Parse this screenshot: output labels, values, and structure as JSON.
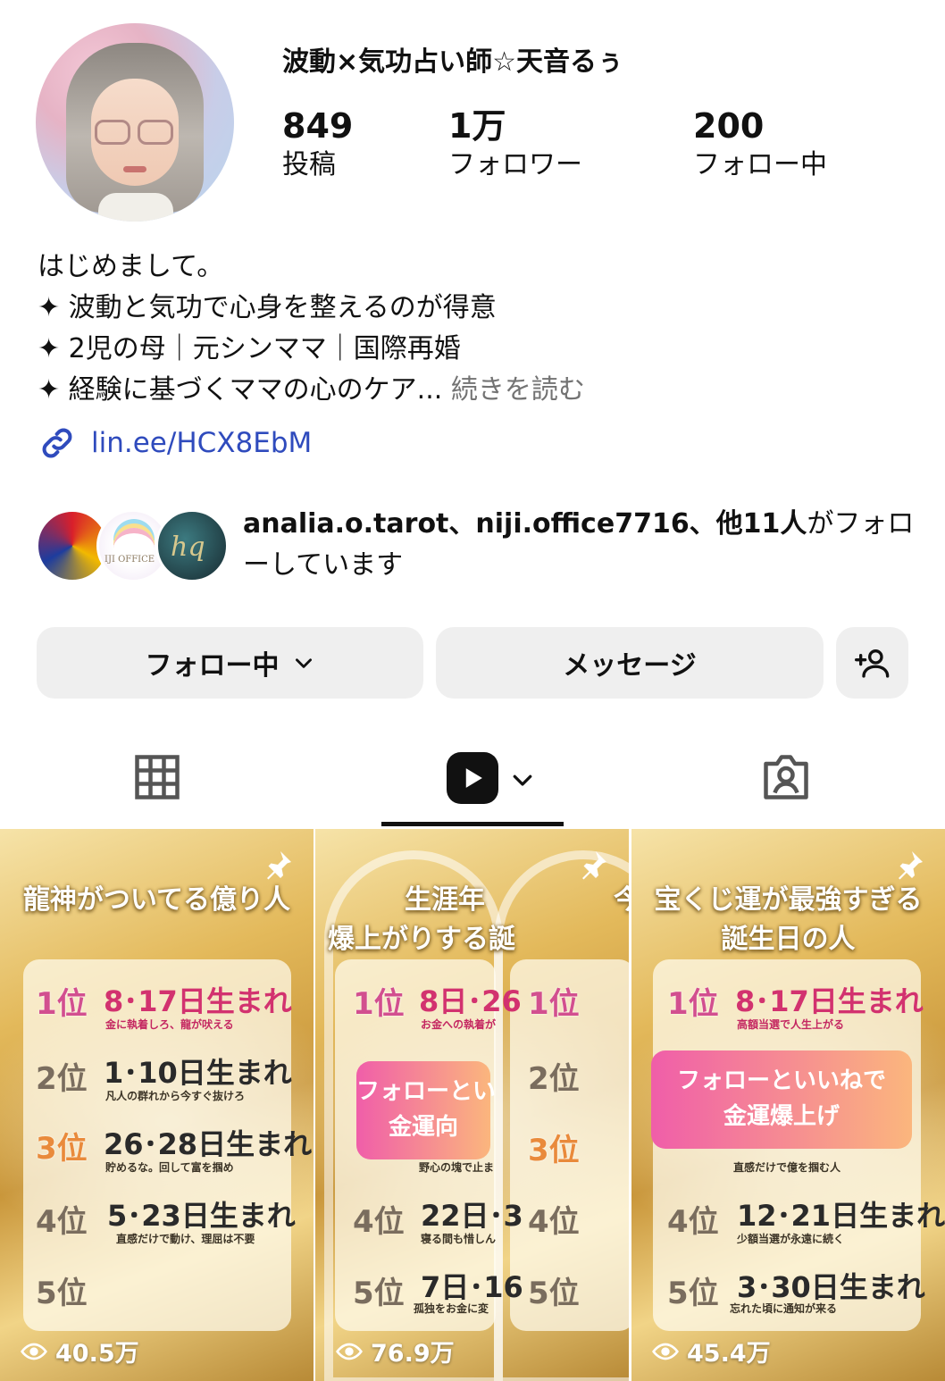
{
  "profile": {
    "username": "波動×気功占い師☆天音るぅ",
    "stats": [
      {
        "value": "849",
        "label": "投稿"
      },
      {
        "value": "1万",
        "label": "フォロワー"
      },
      {
        "value": "200",
        "label": "フォロー中"
      }
    ]
  },
  "bio": {
    "lines": [
      "はじめまして。",
      "✦ 波動と気功で心身を整えるのが得意",
      "✦ 2児の母｜元シンママ｜国際再婚",
      "✦ 経験に基づくママの心のケア..."
    ],
    "more": "続きを読む",
    "link": "lin.ee/HCX8EbM"
  },
  "mutual": {
    "names": "analia.o.tarot、niji.office7716、他11人",
    "suffix": "がフォローしています",
    "avatar2_text": "IJI OFFICE",
    "avatar3_text": "hq"
  },
  "actions": {
    "following": "フォロー中",
    "message": "メッセージ"
  },
  "tabs": [
    "posts-grid",
    "reels",
    "tagged"
  ],
  "reels": [
    {
      "title": "龍神がついてる億り人",
      "views": "40.5万",
      "ranks": [
        "1位",
        "2位",
        "3位",
        "4位",
        "5位"
      ],
      "dates": [
        "8･17日生まれ",
        "1･10日生まれ",
        "26･28日生まれ",
        "5･23日生まれ"
      ],
      "notes": [
        "金に執着しろ、龍が吠える",
        "凡人の群れから今すぐ抜けろ",
        "貯めるな。回して富を掴め",
        "直感だけで動け、理屈は不要"
      ]
    },
    {
      "title_a": "生涯年",
      "title_b": "爆上がりする誕",
      "title_c": "今",
      "views": "76.9万",
      "ranks": [
        "1位",
        "2位",
        "3位",
        "4位",
        "5位"
      ],
      "dates": [
        "8日･26",
        "22日･3",
        "7日･16"
      ],
      "notes": [
        "お金への執着が",
        "野心の塊で止ま",
        "寝る間も惜しん",
        "孤独をお金に変"
      ],
      "cta": [
        "フォローとい",
        "金運向"
      ]
    },
    {
      "title_a": "宝くじ運が最強すぎる",
      "title_b": "誕生日の人",
      "views": "45.4万",
      "ranks": [
        "1位",
        "4位",
        "5位"
      ],
      "dates": [
        "8･17日生まれ",
        "12･21日生まれ",
        "3･30日生まれ"
      ],
      "notes": [
        "高額当選で人生上がる",
        "直感だけで億を掴む人",
        "少額当選が永遠に続く",
        "忘れた頃に通知が来る"
      ],
      "cta": [
        "フォローといいねで",
        "金運爆上げ"
      ]
    }
  ],
  "colors": {
    "link": "#2f4bbd",
    "muted": "#737373",
    "button_bg": "#efefef"
  }
}
